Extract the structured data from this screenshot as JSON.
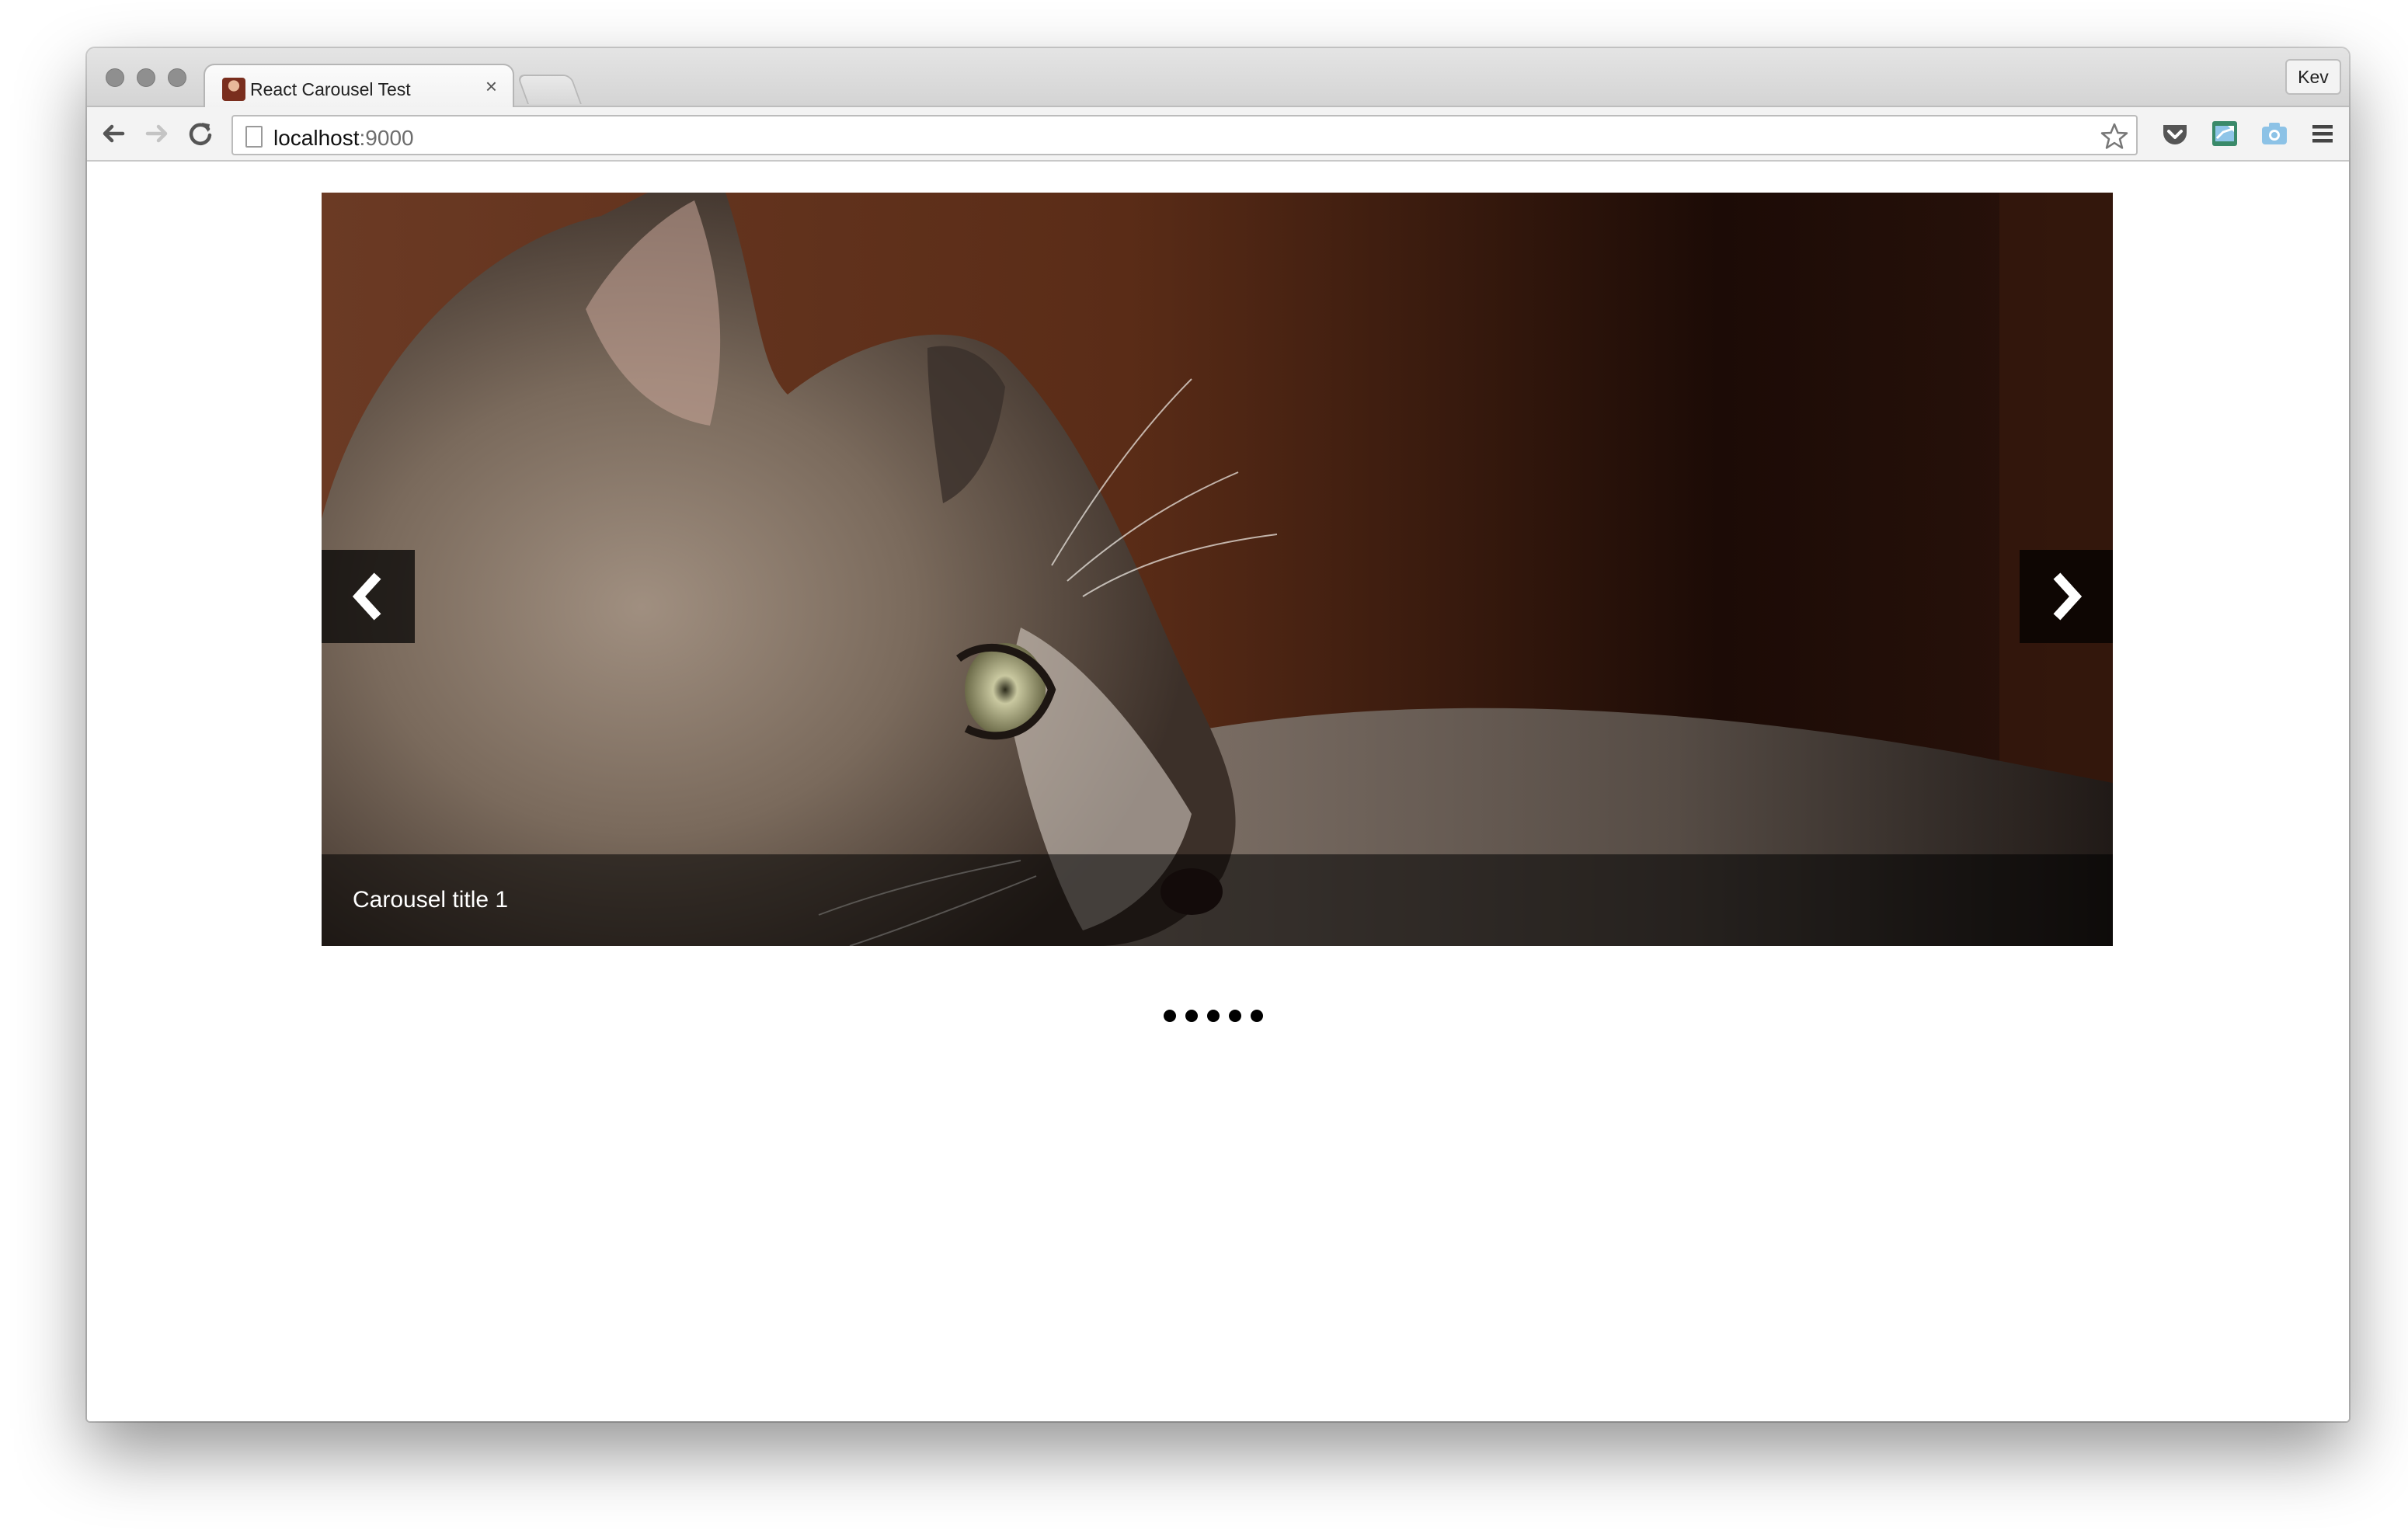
{
  "browser": {
    "tab_title": "React Carousel Test",
    "tab_close": "×",
    "profile_name": "Kev",
    "url_host": "localhost",
    "url_port": ":9000"
  },
  "icons": {
    "back": "arrow-left-icon",
    "forward": "arrow-right-icon",
    "reload": "reload-icon",
    "bookmark": "star-icon",
    "pocket": "pocket-icon",
    "share": "share-icon",
    "camera": "camera-icon",
    "menu": "hamburger-menu-icon"
  },
  "carousel": {
    "caption": "Carousel title 1",
    "slide_count": 5,
    "active_index": 0
  }
}
